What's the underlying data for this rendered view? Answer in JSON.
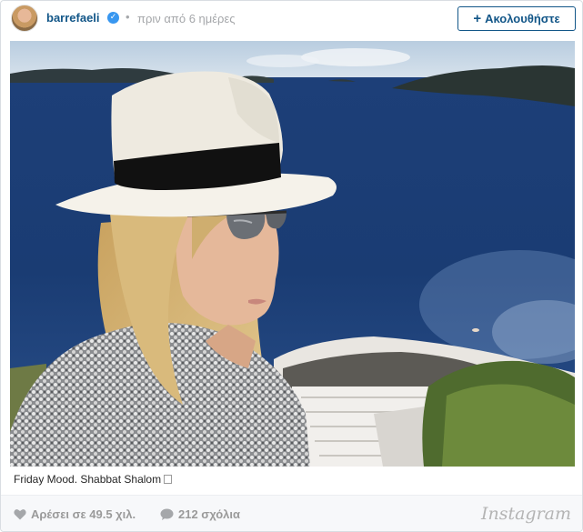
{
  "header": {
    "username": "barrefaeli",
    "verified_icon": "verified-badge-icon",
    "separator": "•",
    "time_ago": "πριν από 6 ημέρες",
    "follow_label": "Ακολουθήστε",
    "follow_icon": "plus-icon"
  },
  "post": {
    "caption": "Friday Mood. Shabbat Shalom"
  },
  "footer": {
    "likes_label": "Αρέσει σε 49.5 χιλ.",
    "comments_label": "212 σχόλια",
    "brand": "Instagram"
  },
  "colors": {
    "link_blue": "#125688",
    "verified_blue": "#3897f0",
    "muted_text": "#a5a7aa",
    "footer_bg": "#f7f8fa"
  }
}
